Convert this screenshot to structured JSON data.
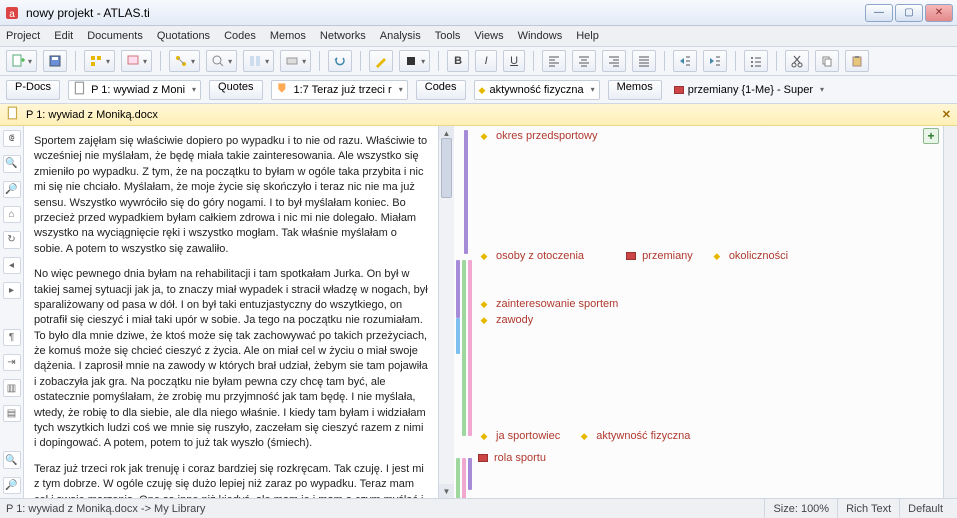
{
  "window": {
    "title": "nowy projekt - ATLAS.ti"
  },
  "menu": [
    "Project",
    "Edit",
    "Documents",
    "Quotations",
    "Codes",
    "Memos",
    "Networks",
    "Analysis",
    "Tools",
    "Views",
    "Windows",
    "Help"
  ],
  "toolbar2": {
    "pdocs": "P-Docs",
    "pdoc_combo": "P 1: wywiad z Moni",
    "quotes_btn": "Quotes",
    "quote_combo": "1:7 Teraz już trzeci r",
    "codes_btn": "Codes",
    "code_combo": "aktywność fizyczna",
    "memos_btn": "Memos",
    "memo_combo": "przemiany {1-Me} - Super"
  },
  "doctab": {
    "label": "P 1: wywiad z Moniką.docx"
  },
  "document": {
    "p1": "Sportem zajęłam się właściwie dopiero po wypadku i to nie od razu. Właściwie to wcześniej nie myślałam, że będę miała takie zainteresowania. Ale wszystko się zmieniło po wypadku. Z tym, że na początku to byłam w ogóle taka przybita i nic mi się nie chciało. Myślałam, że moje życie się skończyło i teraz nic nie ma już sensu. Wszystko wywróciło się do góry nogami. I to był myślałam koniec. Bo przecież przed wypadkiem byłam całkiem zdrowa i nic mi nie dolegało. Miałam wszystko na wyciągnięcie ręki i wszystko mogłam. Tak właśnie myślałam o sobie. A potem to wszystko się zawaliło.",
    "p2": "No więc pewnego dnia byłam na rehabilitacji i tam spotkałam Jurka. On był w takiej samej sytuacji jak ja, to znaczy miał wypadek i stracił władzę w nogach, był sparaliżowany od pasa w dół. I on był taki entuzjastyczny do wszytkiego, on potrafił się cieszyć i miał taki upór w sobie. Ja tego na początku nie rozumiałam. To było dla mnie dziwe, że ktoś może się tak zachowywać po takich przeżyciach, że komuś może się chcieć cieszyć z życia. Ale on miał cel w życiu o miał swoje dążenia. I zaprosił mnie na zawody w których brał udział, żebym sie tam pojawiła i zobaczyła jak gra. Na początku nie byłam pewna czy chcę tam być, ale ostatecznie pomyślałam, że zrobię mu przyjmność jak tam będę. I nie myślała, wtedy, że robię to dla siebie, ale dla niego właśnie. I kiedy tam byłam i widziałam tych wszytkich ludzi coś we mnie się ruszyło, zaczełam się cieszyć razem z nimi i dopingować. A potem, potem to już tak wyszło (śmiech).",
    "p3": "Teraz już trzeci rok jak trenuję i coraz bardziej się rozkręcam. Tak czuję. I jest mi z tym dobrze. W ogóle czuję się dużo lepiej niż zaraz po wypadku. Teraz mam cel i swoje marzenia. One są inne niż kiedyś, ale mam je i mam o czym myśleć i po co się starać. To mi dodaje sił każdego dnia."
  },
  "codes": {
    "r1": {
      "c1": "okres przedsportowy"
    },
    "r2": {
      "c1": "osoby z otoczenia",
      "c2": "przemiany",
      "c3": "okoliczności"
    },
    "r3": {
      "c1": "zainteresowanie sportem",
      "c2": "zawody"
    },
    "r4": {
      "c1": "ja sportowiec",
      "c2": "aktywność fizyczna",
      "c3": "rola sportu"
    }
  },
  "status": {
    "left": "P 1: wywiad z Moniką.docx ->   My Library",
    "size": "Size: 100%",
    "mode": "Rich Text",
    "theme": "Default"
  }
}
